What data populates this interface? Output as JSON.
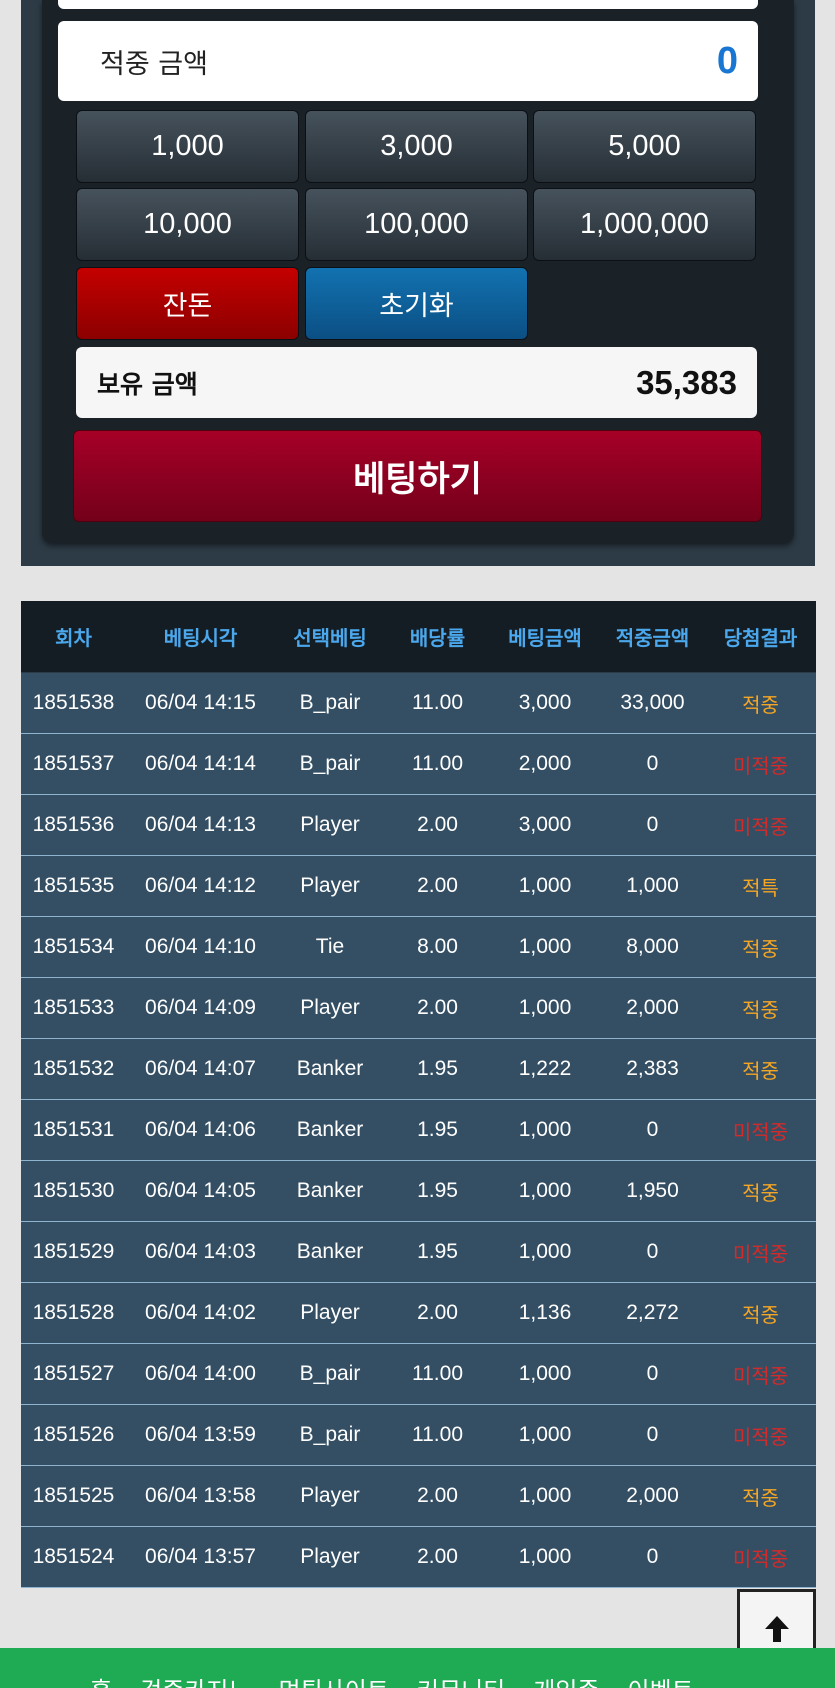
{
  "bet_panel": {
    "win_amount_label": "적중 금액",
    "win_amount_value": "0",
    "chips": [
      "1,000",
      "3,000",
      "5,000",
      "10,000",
      "100,000",
      "1,000,000"
    ],
    "change_label": "잔돈",
    "reset_label": "초기화",
    "balance_label": "보유 금액",
    "balance_value": "35,383",
    "bet_button_label": "베팅하기"
  },
  "history": {
    "columns": [
      "회차",
      "베팅시각",
      "선택베팅",
      "배당률",
      "베팅금액",
      "적중금액",
      "당첨결과"
    ],
    "rows": [
      {
        "round": "1851538",
        "time": "06/04 14:15",
        "pick": "B_pair",
        "odds": "11.00",
        "bet": "3,000",
        "win": "33,000",
        "result": "적중",
        "hit": true
      },
      {
        "round": "1851537",
        "time": "06/04 14:14",
        "pick": "B_pair",
        "odds": "11.00",
        "bet": "2,000",
        "win": "0",
        "result": "미적중",
        "hit": false
      },
      {
        "round": "1851536",
        "time": "06/04 14:13",
        "pick": "Player",
        "odds": "2.00",
        "bet": "3,000",
        "win": "0",
        "result": "미적중",
        "hit": false
      },
      {
        "round": "1851535",
        "time": "06/04 14:12",
        "pick": "Player",
        "odds": "2.00",
        "bet": "1,000",
        "win": "1,000",
        "result": "적특",
        "hit": true
      },
      {
        "round": "1851534",
        "time": "06/04 14:10",
        "pick": "Tie",
        "odds": "8.00",
        "bet": "1,000",
        "win": "8,000",
        "result": "적중",
        "hit": true
      },
      {
        "round": "1851533",
        "time": "06/04 14:09",
        "pick": "Player",
        "odds": "2.00",
        "bet": "1,000",
        "win": "2,000",
        "result": "적중",
        "hit": true
      },
      {
        "round": "1851532",
        "time": "06/04 14:07",
        "pick": "Banker",
        "odds": "1.95",
        "bet": "1,222",
        "win": "2,383",
        "result": "적중",
        "hit": true
      },
      {
        "round": "1851531",
        "time": "06/04 14:06",
        "pick": "Banker",
        "odds": "1.95",
        "bet": "1,000",
        "win": "0",
        "result": "미적중",
        "hit": false
      },
      {
        "round": "1851530",
        "time": "06/04 14:05",
        "pick": "Banker",
        "odds": "1.95",
        "bet": "1,000",
        "win": "1,950",
        "result": "적중",
        "hit": true
      },
      {
        "round": "1851529",
        "time": "06/04 14:03",
        "pick": "Banker",
        "odds": "1.95",
        "bet": "1,000",
        "win": "0",
        "result": "미적중",
        "hit": false
      },
      {
        "round": "1851528",
        "time": "06/04 14:02",
        "pick": "Player",
        "odds": "2.00",
        "bet": "1,136",
        "win": "2,272",
        "result": "적중",
        "hit": true
      },
      {
        "round": "1851527",
        "time": "06/04 14:00",
        "pick": "B_pair",
        "odds": "11.00",
        "bet": "1,000",
        "win": "0",
        "result": "미적중",
        "hit": false
      },
      {
        "round": "1851526",
        "time": "06/04 13:59",
        "pick": "B_pair",
        "odds": "11.00",
        "bet": "1,000",
        "win": "0",
        "result": "미적중",
        "hit": false
      },
      {
        "round": "1851525",
        "time": "06/04 13:58",
        "pick": "Player",
        "odds": "2.00",
        "bet": "1,000",
        "win": "2,000",
        "result": "적중",
        "hit": true
      },
      {
        "round": "1851524",
        "time": "06/04 13:57",
        "pick": "Player",
        "odds": "2.00",
        "bet": "1,000",
        "win": "0",
        "result": "미적중",
        "hit": false
      }
    ]
  },
  "footer_nav": [
    "홈",
    "검증카지노",
    "먹튀사이트",
    "커뮤니티",
    "게임존",
    "이벤트"
  ],
  "colors": {
    "hit": "#f5a623",
    "miss": "#d42a2a",
    "header_text": "#4ba8ec",
    "footer_bg": "#1eab54"
  },
  "icons": {
    "scroll_top": "arrow-up-icon"
  }
}
